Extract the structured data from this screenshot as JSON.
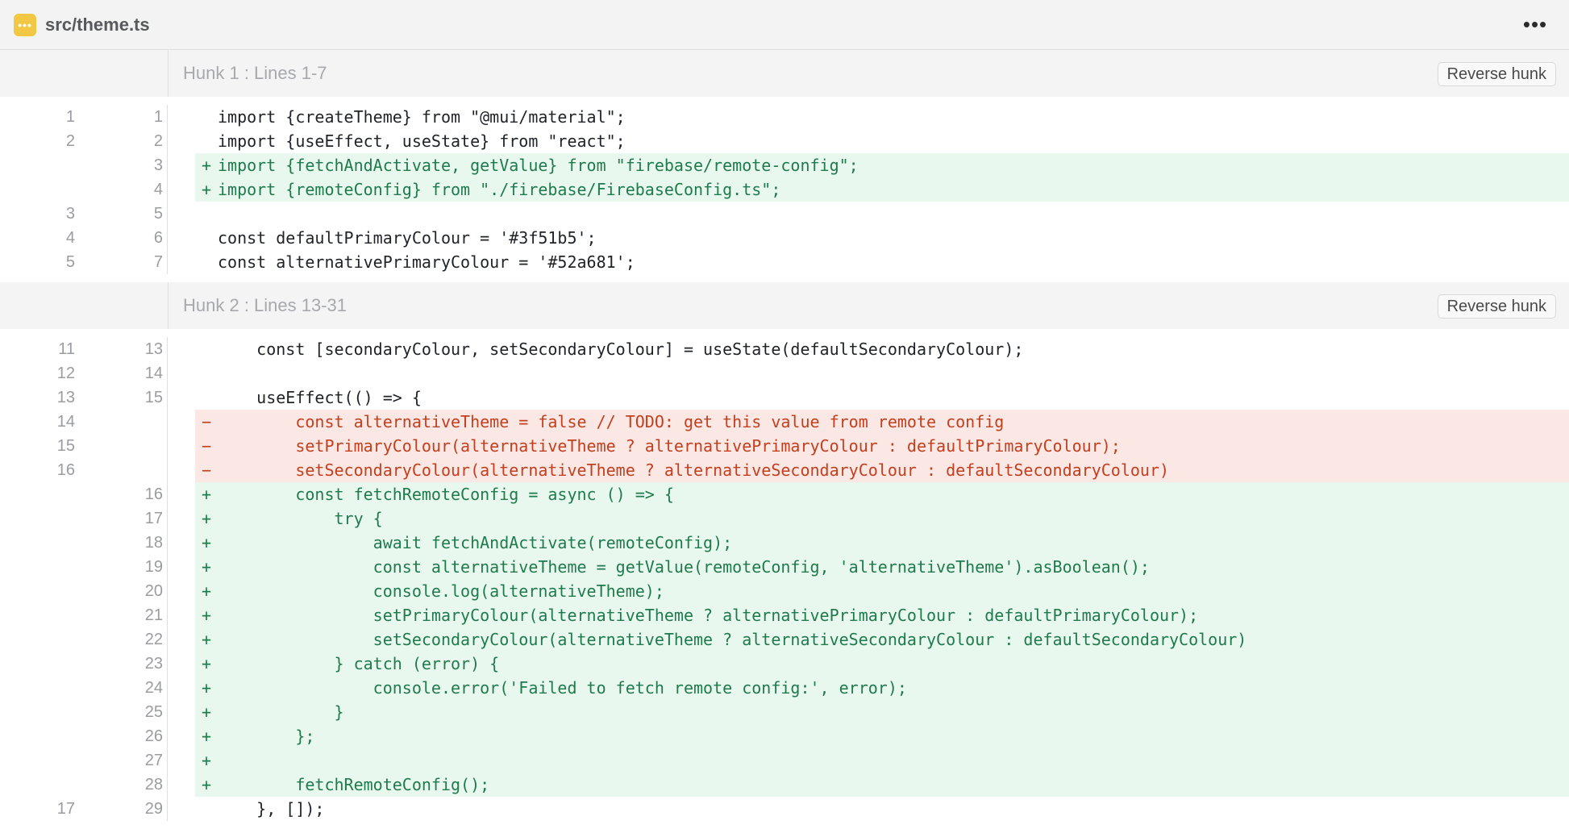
{
  "file": {
    "path": "src/theme.ts",
    "icon": "file-code-icon",
    "icon_glyph": "•••",
    "more_glyph": "•••"
  },
  "hunks": [
    {
      "title": "Hunk 1 : Lines 1-7",
      "reverse_label": "Reverse hunk",
      "lines": [
        {
          "old": "1",
          "new": "1",
          "type": "ctx",
          "sign": "",
          "code": "import {createTheme} from \"@mui/material\";"
        },
        {
          "old": "2",
          "new": "2",
          "type": "ctx",
          "sign": "",
          "code": "import {useEffect, useState} from \"react\";"
        },
        {
          "old": "",
          "new": "3",
          "type": "add",
          "sign": "+",
          "code": "import {fetchAndActivate, getValue} from \"firebase/remote-config\";"
        },
        {
          "old": "",
          "new": "4",
          "type": "add",
          "sign": "+",
          "code": "import {remoteConfig} from \"./firebase/FirebaseConfig.ts\";"
        },
        {
          "old": "3",
          "new": "5",
          "type": "ctx",
          "sign": "",
          "code": ""
        },
        {
          "old": "4",
          "new": "6",
          "type": "ctx",
          "sign": "",
          "code": "const defaultPrimaryColour = '#3f51b5';"
        },
        {
          "old": "5",
          "new": "7",
          "type": "ctx",
          "sign": "",
          "code": "const alternativePrimaryColour = '#52a681';"
        }
      ]
    },
    {
      "title": "Hunk 2 : Lines 13-31",
      "reverse_label": "Reverse hunk",
      "lines": [
        {
          "old": "11",
          "new": "13",
          "type": "ctx",
          "sign": "",
          "code": "    const [secondaryColour, setSecondaryColour] = useState(defaultSecondaryColour);"
        },
        {
          "old": "12",
          "new": "14",
          "type": "ctx",
          "sign": "",
          "code": ""
        },
        {
          "old": "13",
          "new": "15",
          "type": "ctx",
          "sign": "",
          "code": "    useEffect(() => {"
        },
        {
          "old": "14",
          "new": "",
          "type": "del",
          "sign": "−",
          "code": "        const alternativeTheme = false // TODO: get this value from remote config"
        },
        {
          "old": "15",
          "new": "",
          "type": "del",
          "sign": "−",
          "code": "        setPrimaryColour(alternativeTheme ? alternativePrimaryColour : defaultPrimaryColour);"
        },
        {
          "old": "16",
          "new": "",
          "type": "del",
          "sign": "−",
          "code": "        setSecondaryColour(alternativeTheme ? alternativeSecondaryColour : defaultSecondaryColour)"
        },
        {
          "old": "",
          "new": "16",
          "type": "add",
          "sign": "+",
          "code": "        const fetchRemoteConfig = async () => {"
        },
        {
          "old": "",
          "new": "17",
          "type": "add",
          "sign": "+",
          "code": "            try {"
        },
        {
          "old": "",
          "new": "18",
          "type": "add",
          "sign": "+",
          "code": "                await fetchAndActivate(remoteConfig);"
        },
        {
          "old": "",
          "new": "19",
          "type": "add",
          "sign": "+",
          "code": "                const alternativeTheme = getValue(remoteConfig, 'alternativeTheme').asBoolean();"
        },
        {
          "old": "",
          "new": "20",
          "type": "add",
          "sign": "+",
          "code": "                console.log(alternativeTheme);"
        },
        {
          "old": "",
          "new": "21",
          "type": "add",
          "sign": "+",
          "code": "                setPrimaryColour(alternativeTheme ? alternativePrimaryColour : defaultPrimaryColour);"
        },
        {
          "old": "",
          "new": "22",
          "type": "add",
          "sign": "+",
          "code": "                setSecondaryColour(alternativeTheme ? alternativeSecondaryColour : defaultSecondaryColour)"
        },
        {
          "old": "",
          "new": "23",
          "type": "add",
          "sign": "+",
          "code": "            } catch (error) {"
        },
        {
          "old": "",
          "new": "24",
          "type": "add",
          "sign": "+",
          "code": "                console.error('Failed to fetch remote config:', error);"
        },
        {
          "old": "",
          "new": "25",
          "type": "add",
          "sign": "+",
          "code": "            }"
        },
        {
          "old": "",
          "new": "26",
          "type": "add",
          "sign": "+",
          "code": "        };"
        },
        {
          "old": "",
          "new": "27",
          "type": "add",
          "sign": "+",
          "code": ""
        },
        {
          "old": "",
          "new": "28",
          "type": "add",
          "sign": "+",
          "code": "        fetchRemoteConfig();"
        },
        {
          "old": "17",
          "new": "29",
          "type": "ctx",
          "sign": "",
          "code": "    }, []);"
        }
      ]
    }
  ],
  "colors": {
    "add_bg": "#e9f8ef",
    "add_text": "#1f7a4c",
    "del_bg": "#fbe7e3",
    "del_text": "#c2401f",
    "file_icon_bg": "#f2c744"
  }
}
